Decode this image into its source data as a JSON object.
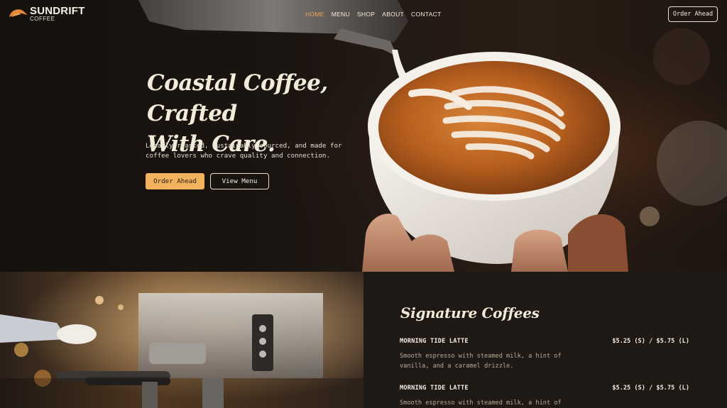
{
  "brand": {
    "name": "SUNDRIFT",
    "sub": "COFFEE"
  },
  "nav": {
    "items": [
      {
        "label": "HOME",
        "active": true
      },
      {
        "label": "MENU",
        "active": false
      },
      {
        "label": "SHOP",
        "active": false
      },
      {
        "label": "ABOUT",
        "active": false
      },
      {
        "label": "CONTACT",
        "active": false
      }
    ],
    "cta": "Order Ahead"
  },
  "hero": {
    "title_line1": "Coastal Coffee, Crafted",
    "title_line2": "With Care.",
    "description": "Locally roasted, sustainably sourced, and made for coffee lovers who crave quality and connection.",
    "primary_button": "Order Ahead",
    "secondary_button": "View Menu"
  },
  "menu_section": {
    "heading": "Signature Coffees",
    "items": [
      {
        "name": "MORNING TIDE LATTE",
        "price": "$5.25 (S) / $5.75 (L)",
        "description": "Smooth espresso with steamed milk, a hint of vanilla, and a caramel drizzle."
      },
      {
        "name": "MORNING TIDE LATTE",
        "price": "$5.25 (S) / $5.75 (L)",
        "description": "Smooth espresso with steamed milk, a hint of vanilla, and a caramel drizzle."
      }
    ]
  },
  "colors": {
    "accent": "#f2b25e",
    "active_nav": "#f0a45a",
    "background": "#1a1613",
    "panel": "#1e1915"
  }
}
